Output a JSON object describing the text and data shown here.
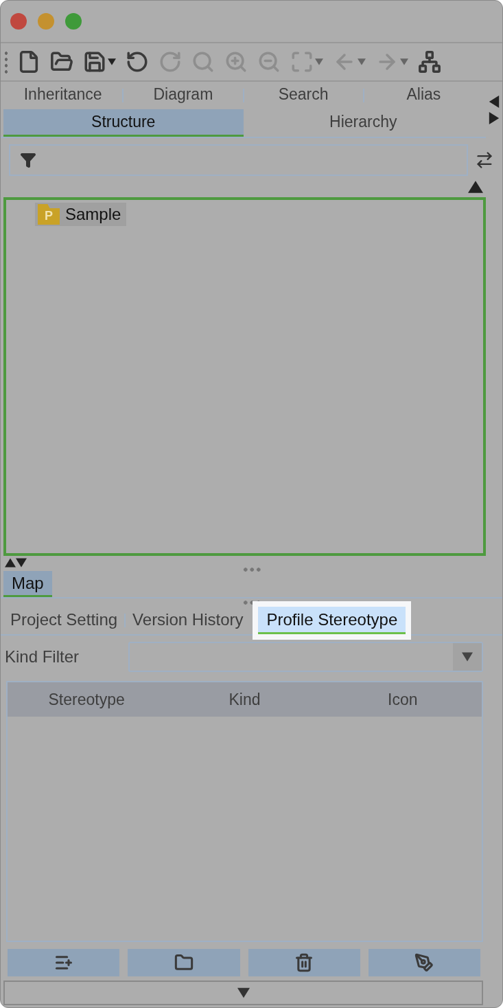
{
  "toolbar": [
    {
      "kind": "new",
      "disabled": false
    },
    {
      "kind": "open",
      "disabled": false
    },
    {
      "kind": "save",
      "disabled": false,
      "menu": true
    },
    {
      "kind": "undo",
      "disabled": false
    },
    {
      "kind": "redo",
      "disabled": true
    },
    {
      "kind": "zoom-actual",
      "disabled": true
    },
    {
      "kind": "zoom-in",
      "disabled": true
    },
    {
      "kind": "zoom-out",
      "disabled": true
    },
    {
      "kind": "fit",
      "disabled": true,
      "menu": true
    },
    {
      "kind": "back",
      "disabled": true,
      "menu": true
    },
    {
      "kind": "forward",
      "disabled": true,
      "menu": true
    },
    {
      "kind": "layout",
      "disabled": false
    }
  ],
  "top_tabs": [
    [
      {
        "label": "Inheritance",
        "selected": false
      },
      {
        "label": "Diagram",
        "selected": false
      },
      {
        "label": "Search",
        "selected": false
      },
      {
        "label": "Alias",
        "selected": false
      }
    ],
    [
      {
        "label": "Structure",
        "selected": true
      },
      {
        "label": "Hierarchy",
        "selected": false
      }
    ]
  ],
  "tree": [
    {
      "label": "Sample",
      "badge": "P",
      "selected": true
    }
  ],
  "map_tab": {
    "label": "Map",
    "selected": true
  },
  "bottom_tabs": [
    {
      "label": "Project Setting",
      "selected": false
    },
    {
      "label": "Version History",
      "selected": false
    },
    {
      "label": "Profile Stereotype",
      "selected": true
    }
  ],
  "kind_filter": {
    "label": "Kind Filter"
  },
  "table": {
    "columns": [
      "Stereotype",
      "Kind",
      "Icon"
    ]
  },
  "actions": [
    {
      "kind": "add"
    },
    {
      "kind": "folder"
    },
    {
      "kind": "delete"
    },
    {
      "kind": "edit"
    }
  ]
}
